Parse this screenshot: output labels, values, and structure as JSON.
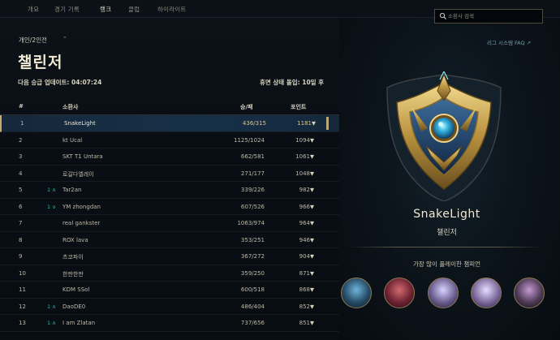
{
  "nav": {
    "tabs": [
      {
        "label": "개요"
      },
      {
        "label": "경기 기록"
      },
      {
        "label": "랭크"
      },
      {
        "label": "클럽"
      },
      {
        "label": "하이라이트"
      }
    ],
    "active_tab": "랭크"
  },
  "search": {
    "placeholder": "소환사 검색",
    "value": ""
  },
  "ladder": {
    "queue": "개인/2인전",
    "tier": "챌린저",
    "next_update": "다음 승급 업데이트: 04:07:24",
    "inactivity": "휴면 상태 돌입: 10일 후",
    "columns": {
      "rank": "#",
      "summoner": "소환사",
      "wins_losses": "승/패",
      "points": "포인트"
    },
    "rows": [
      {
        "rank": "1",
        "change": "",
        "name": "SnakeLight",
        "wl": "436/315",
        "points": "1181",
        "highlight": true
      },
      {
        "rank": "2",
        "change": "",
        "name": "kt Ucal",
        "wl": "1125/1024",
        "points": "1094"
      },
      {
        "rank": "3",
        "change": "",
        "name": "SKT T1 Untara",
        "wl": "662/581",
        "points": "1061"
      },
      {
        "rank": "4",
        "change": "",
        "name": "로갈다엘레이",
        "wl": "271/177",
        "points": "1048"
      },
      {
        "rank": "5",
        "change": "1 ∧",
        "name": "Tar2an",
        "wl": "339/226",
        "points": "982"
      },
      {
        "rank": "6",
        "change": "1 ∨",
        "name": "YM zhongdan",
        "wl": "607/526",
        "points": "966"
      },
      {
        "rank": "7",
        "change": "",
        "name": "real gankster",
        "wl": "1063/974",
        "points": "964"
      },
      {
        "rank": "8",
        "change": "",
        "name": "ROX lava",
        "wl": "353/251",
        "points": "946"
      },
      {
        "rank": "9",
        "change": "",
        "name": "츠코파이",
        "wl": "367/272",
        "points": "904"
      },
      {
        "rank": "10",
        "change": "",
        "name": "한판한판",
        "wl": "359/250",
        "points": "871"
      },
      {
        "rank": "11",
        "change": "",
        "name": "KDM SSol",
        "wl": "600/518",
        "points": "868"
      },
      {
        "rank": "12",
        "change": "1 ∧",
        "name": "DaoDE0",
        "wl": "486/404",
        "points": "852"
      },
      {
        "rank": "13",
        "change": "1 ∧",
        "name": "I am Zlatan",
        "wl": "737/656",
        "points": "851"
      }
    ]
  },
  "side": {
    "faq_link": "리그 시스템 FAQ ↗",
    "player_name": "SnakeLight",
    "player_tier": "챌린저",
    "most_played_label": "가장 많이 플레이한 챔피언",
    "champions": [
      {
        "icon": "champion-1-icon",
        "color": "#3f6c8c"
      },
      {
        "icon": "champion-2-icon",
        "color": "#8a2f3c"
      },
      {
        "icon": "champion-3-icon",
        "color": "#6b5e8f"
      },
      {
        "icon": "champion-4-icon",
        "color": "#7d6a9d"
      },
      {
        "icon": "champion-5-icon",
        "color": "#4d3a55"
      }
    ]
  },
  "colors": {
    "accent": "#c8aa6e",
    "teal": "#0ac8b9",
    "background": "#070d13"
  }
}
